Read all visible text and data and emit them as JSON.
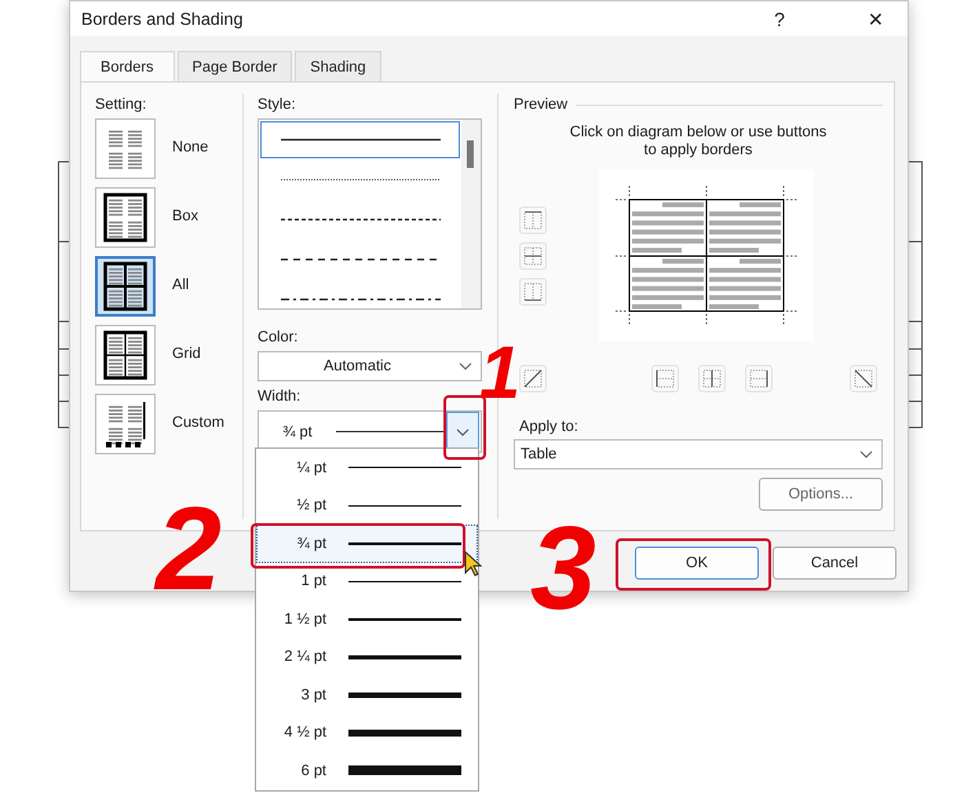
{
  "window": {
    "title": "Borders and Shading",
    "help": "?",
    "close": "✕"
  },
  "tabs": [
    {
      "label": "Borders",
      "selected": true
    },
    {
      "label": "Page Border",
      "selected": false
    },
    {
      "label": "Shading",
      "selected": false
    }
  ],
  "setting": {
    "label": "Setting:",
    "items": [
      {
        "label": "None",
        "kind": "none",
        "selected": false
      },
      {
        "label": "Box",
        "kind": "box",
        "selected": false
      },
      {
        "label": "All",
        "kind": "all",
        "selected": true
      },
      {
        "label": "Grid",
        "kind": "grid",
        "selected": false
      },
      {
        "label": "Custom",
        "kind": "custom",
        "selected": false
      }
    ]
  },
  "style": {
    "label": "Style:",
    "items": [
      {
        "kind": "solid",
        "selected": true
      },
      {
        "kind": "dotted",
        "selected": false
      },
      {
        "kind": "dashed",
        "selected": false
      },
      {
        "kind": "long-dash",
        "selected": false
      },
      {
        "kind": "dash-dot",
        "selected": false
      }
    ]
  },
  "color": {
    "label": "Color:",
    "value": "Automatic"
  },
  "width": {
    "label": "Width:",
    "value": "¾ pt",
    "expanded": true,
    "options": [
      {
        "label": "¼ pt",
        "selected": false
      },
      {
        "label": "½ pt",
        "selected": false
      },
      {
        "label": "¾ pt",
        "selected": true
      },
      {
        "label": "1 pt",
        "selected": false
      },
      {
        "label": "1 ½ pt",
        "selected": false
      },
      {
        "label": "2 ¼ pt",
        "selected": false
      },
      {
        "label": "3 pt",
        "selected": false
      },
      {
        "label": "4 ½ pt",
        "selected": false
      },
      {
        "label": "6 pt",
        "selected": false
      }
    ]
  },
  "preview": {
    "label": "Preview",
    "hint": "Click on diagram below or use buttons to apply borders"
  },
  "apply_to": {
    "label": "Apply to:",
    "value": "Table"
  },
  "buttons": {
    "options": "Options...",
    "ok": "OK",
    "cancel": "Cancel"
  },
  "annotations": [
    {
      "label": "1"
    },
    {
      "label": "2"
    },
    {
      "label": "3"
    }
  ]
}
